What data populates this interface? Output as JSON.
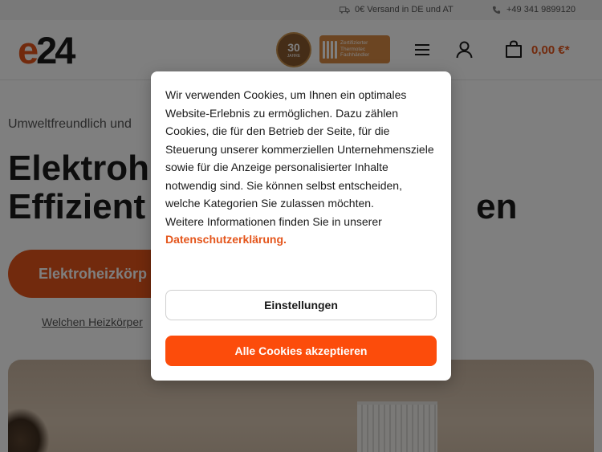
{
  "topbar": {
    "shipping": "0€ Versand in DE und AT",
    "phone": "+49 341 9899120"
  },
  "header": {
    "logo_e": "e",
    "logo_rest": "24",
    "badge_years": "30",
    "badge_years_text": "JAHRE",
    "cert_text_lines": [
      "Zertifizierter",
      "Thermotec",
      "Fachhändler"
    ],
    "cart_total": "0,00 €*"
  },
  "page": {
    "subtitle": "Umweltfreundlich und",
    "headline_line1": "Elektroh",
    "headline_line2": "Effizient",
    "headline_line2_end": "en",
    "cta_label": "Elektroheizkörp",
    "link_text": "Welchen Heizkörper"
  },
  "cookie": {
    "body": "Wir verwenden Cookies, um Ihnen ein optimales Website-Erlebnis zu ermöglichen. Dazu zählen Cookies, die für den Betrieb der Seite, für die Steuerung unserer kommerziellen Unternehmensziele sowie für die Anzeige personalisierter Inhalte notwendig sind. Sie können selbst entscheiden, welche Kategorien Sie zulassen möchten.",
    "more_info": "Weitere Informationen finden Sie in unserer",
    "privacy_link": "Datenschutzerklärung.",
    "settings_button": "Einstellungen",
    "accept_button": "Alle Cookies akzeptieren"
  },
  "colors": {
    "accent": "#e4551b",
    "accept": "#fc4c0b"
  }
}
